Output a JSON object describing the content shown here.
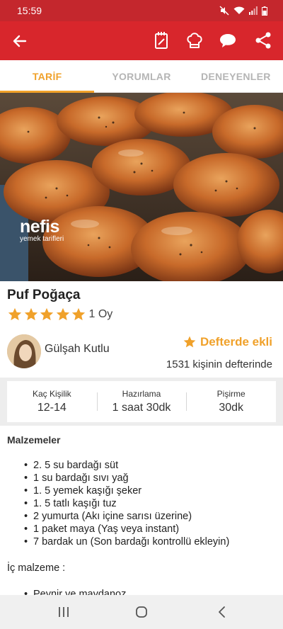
{
  "status": {
    "time": "15:59"
  },
  "tabs": [
    {
      "label": "TARİF",
      "active": true
    },
    {
      "label": "YORUMLAR",
      "active": false
    },
    {
      "label": "DENEYENLER",
      "active": false
    }
  ],
  "hero": {
    "logo": "nefis",
    "logo_sub": "yemek tarifleri"
  },
  "recipe": {
    "title": "Puf Poğaça",
    "stars": 5,
    "votes": "1 Oy",
    "author": "Gülşah Kutlu",
    "favorite_label": "Defterde ekli",
    "favorite_count": "1531 kişinin defterinde"
  },
  "stats": [
    {
      "label": "Kaç Kişilik",
      "value": "12-14"
    },
    {
      "label": "Hazırlama",
      "value": "1 saat 30dk"
    },
    {
      "label": "Pişirme",
      "value": "30dk"
    }
  ],
  "ingredients": {
    "title": "Malzemeler",
    "items": [
      "2. 5 su bardağı süt",
      "1 su bardağı sıvı yağ",
      "1. 5 yemek kaşığı şeker",
      "1. 5 tatlı kaşığı tuz",
      "2 yumurta (Akı içine sarısı üzerine)",
      "1 paket maya (Yaş veya instant)",
      "7 bardak un (Son bardağı kontrollü ekleyin)"
    ],
    "filling_title": "İç malzeme :",
    "filling_items": [
      "Peynir ve maydanoz"
    ]
  },
  "colors": {
    "brand_red": "#d8262c",
    "accent": "#f0a12a"
  },
  "icons": [
    "back-arrow-icon",
    "notebook-icon",
    "chef-hat-icon",
    "comment-icon",
    "share-icon",
    "star-icon",
    "recents-icon",
    "home-icon",
    "nav-back-icon"
  ]
}
